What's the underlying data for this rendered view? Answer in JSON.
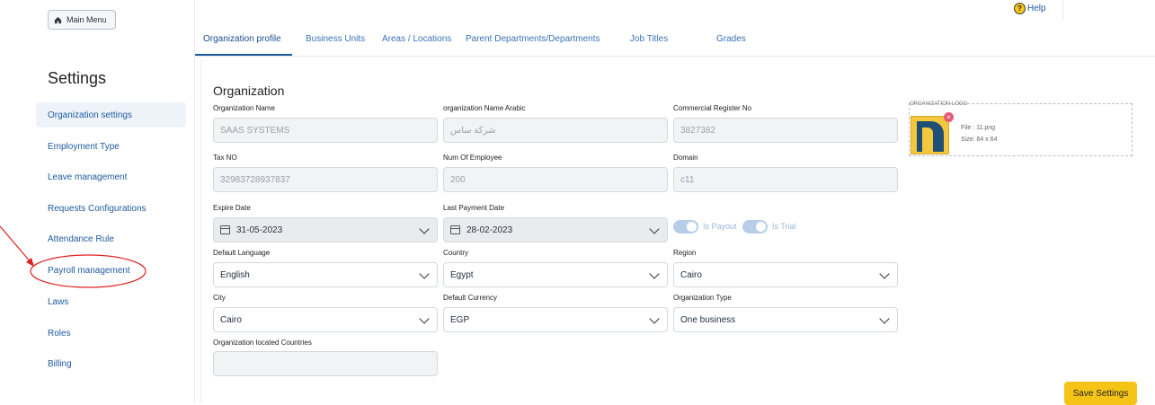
{
  "sidebar": {
    "main_menu_label": "Main Menu",
    "title": "Settings",
    "items": [
      {
        "label": "Organization settings"
      },
      {
        "label": "Employment Type"
      },
      {
        "label": "Leave management"
      },
      {
        "label": "Requests Configurations"
      },
      {
        "label": "Attendance Rule"
      },
      {
        "label": "Payroll management"
      },
      {
        "label": "Laws"
      },
      {
        "label": "Roles"
      },
      {
        "label": "Billing"
      }
    ]
  },
  "header": {
    "help_label": "Help",
    "tabs": [
      {
        "label": "Organization profile"
      },
      {
        "label": "Business Units"
      },
      {
        "label": "Areas / Locations"
      },
      {
        "label": "Parent Departments/Departments"
      },
      {
        "label": "Job Titles"
      },
      {
        "label": "Grades"
      }
    ]
  },
  "form": {
    "section_title": "Organization",
    "org_name": {
      "label": "Organization Name",
      "value": "SAAS SYSTEMS"
    },
    "org_name_ar": {
      "label": "organization Name Arabic",
      "value": "شركة ساس"
    },
    "commercial_reg": {
      "label": "Commercial Register No",
      "value": "3827382"
    },
    "tax_no": {
      "label": "Tax NO",
      "value": "32983728937837"
    },
    "num_employee": {
      "label": "Num Of Employee",
      "value": "200"
    },
    "domain": {
      "label": "Domain",
      "value": "c11"
    },
    "expire_date": {
      "label": "Expire Date",
      "value": "31-05-2023"
    },
    "last_payment": {
      "label": "Last Payment Date",
      "value": "28-02-2023"
    },
    "is_payout": {
      "label": "Is Payout",
      "on": true
    },
    "is_trial": {
      "label": "Is Trial",
      "on": true
    },
    "default_language": {
      "label": "Default Language",
      "value": "English"
    },
    "country": {
      "label": "Country",
      "value": "Egypt"
    },
    "region": {
      "label": "Region",
      "value": "Cairo"
    },
    "city": {
      "label": "City",
      "value": "Cairo"
    },
    "default_currency": {
      "label": "Default Currency",
      "value": "EGP"
    },
    "org_type": {
      "label": "Organization Type",
      "value": "One business"
    },
    "located_countries": {
      "label": "Organization located Countries",
      "value": ""
    }
  },
  "logo": {
    "label": "ORGANIZATION LOGO",
    "file": "File : 11.png",
    "size": "Size: 64 x 64"
  },
  "save_label": "Save Settings",
  "colors": {
    "accent": "#1c5a9e",
    "save_button": "#f6c416",
    "annotation": "#e02020"
  }
}
